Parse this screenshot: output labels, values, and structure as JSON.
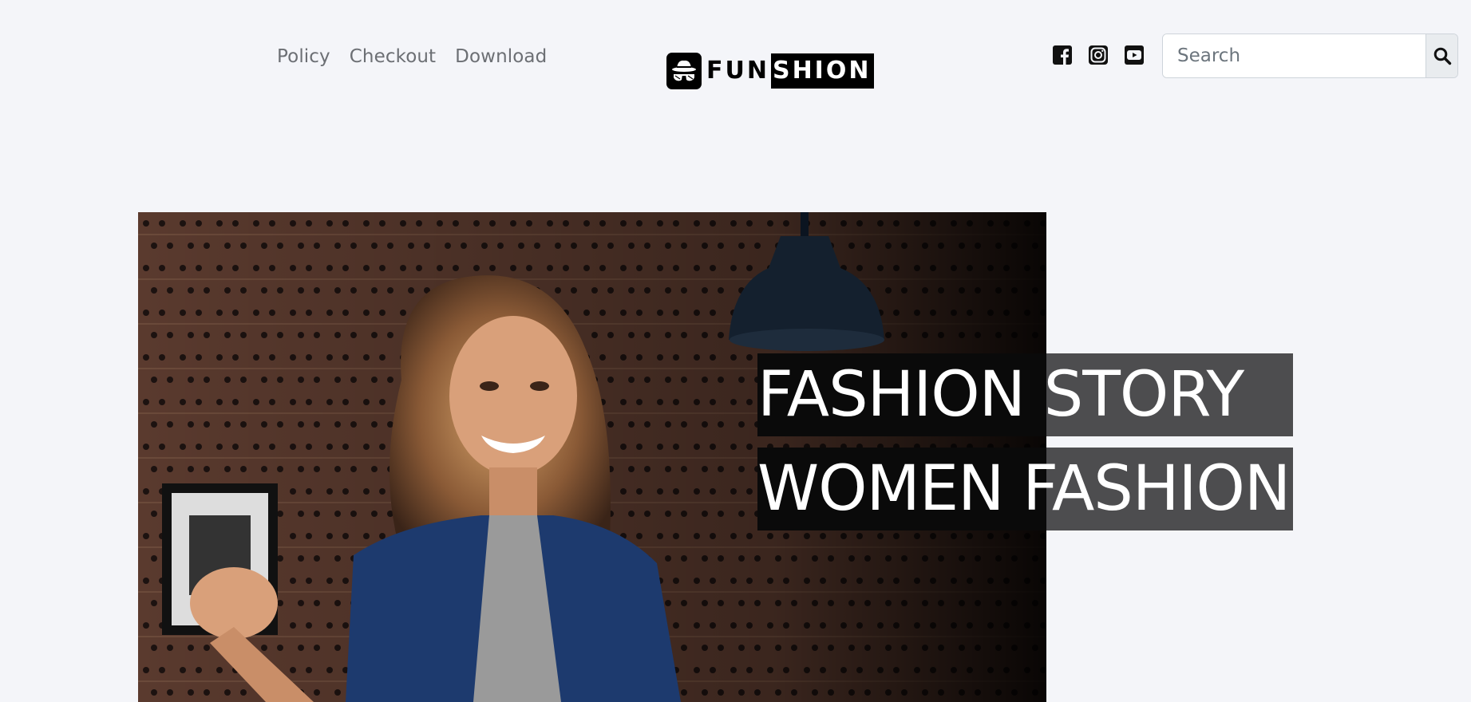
{
  "nav": {
    "items": [
      {
        "label": "Policy"
      },
      {
        "label": "Checkout"
      },
      {
        "label": "Download"
      }
    ]
  },
  "logo": {
    "part1": "FUN",
    "part2": "SHION",
    "icon": "hat-glasses-icon"
  },
  "social": {
    "icons": [
      "facebook-icon",
      "instagram-icon",
      "youtube-icon"
    ]
  },
  "search": {
    "placeholder": "Search",
    "button_icon": "search-icon"
  },
  "hero": {
    "line1": "FASHION STORY",
    "line2": "WOMEN FASHION",
    "image": "woman-in-denim-jacket-photo"
  },
  "colors": {
    "background": "#f4f5f9",
    "nav_text": "#6c6f74",
    "title_bg": "#464648"
  }
}
